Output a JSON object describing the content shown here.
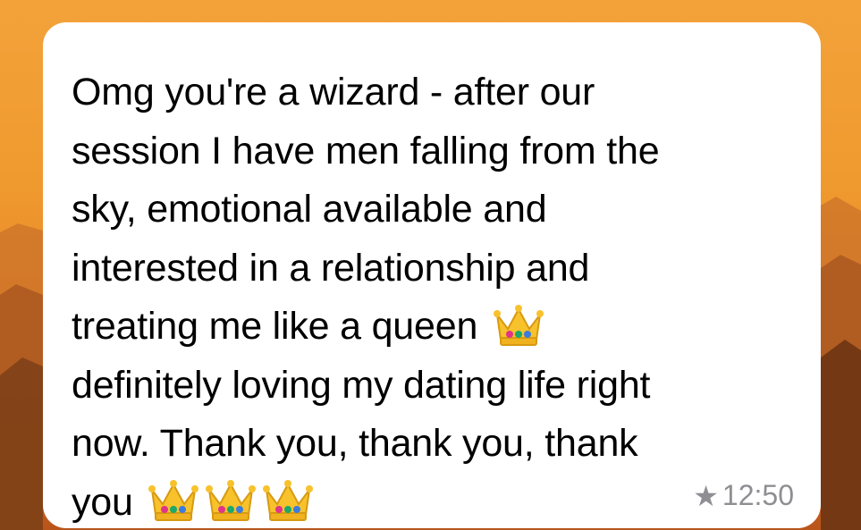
{
  "message": {
    "lines": [
      "Omg you're  a wizard - after our",
      "session I have men falling from the",
      "sky, emotional available and",
      "interested in a relationship and",
      "treating me like a queen",
      "definitely loving my dating life right",
      "now. Thank you, thank you, thank",
      "you"
    ],
    "line5_emoji": "crown-icon",
    "line8_emoji": [
      "crown-icon",
      "crown-icon",
      "crown-icon"
    ]
  },
  "meta": {
    "starred_icon": "star-icon",
    "time": "12:50"
  },
  "colors": {
    "bubble": "#ffffff",
    "text": "#000000",
    "meta": "#8e8e93",
    "background_top": "#f3a23a",
    "background_bottom": "#b9541b"
  }
}
